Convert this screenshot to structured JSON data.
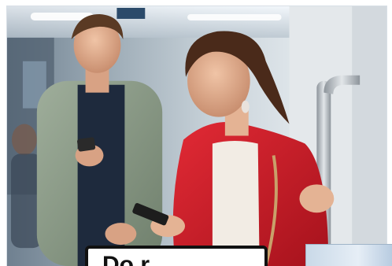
{
  "scene": {
    "background": "#ffffff",
    "caption_text": "Do r",
    "colors": {
      "train_interior": "#cfd8de",
      "red_coat": "#d11f2b",
      "grey_jacket": "#8a9a86",
      "navy_shirt": "#1e2a3d",
      "handrail": "#b9bec4",
      "caption_border": "#111111"
    }
  }
}
